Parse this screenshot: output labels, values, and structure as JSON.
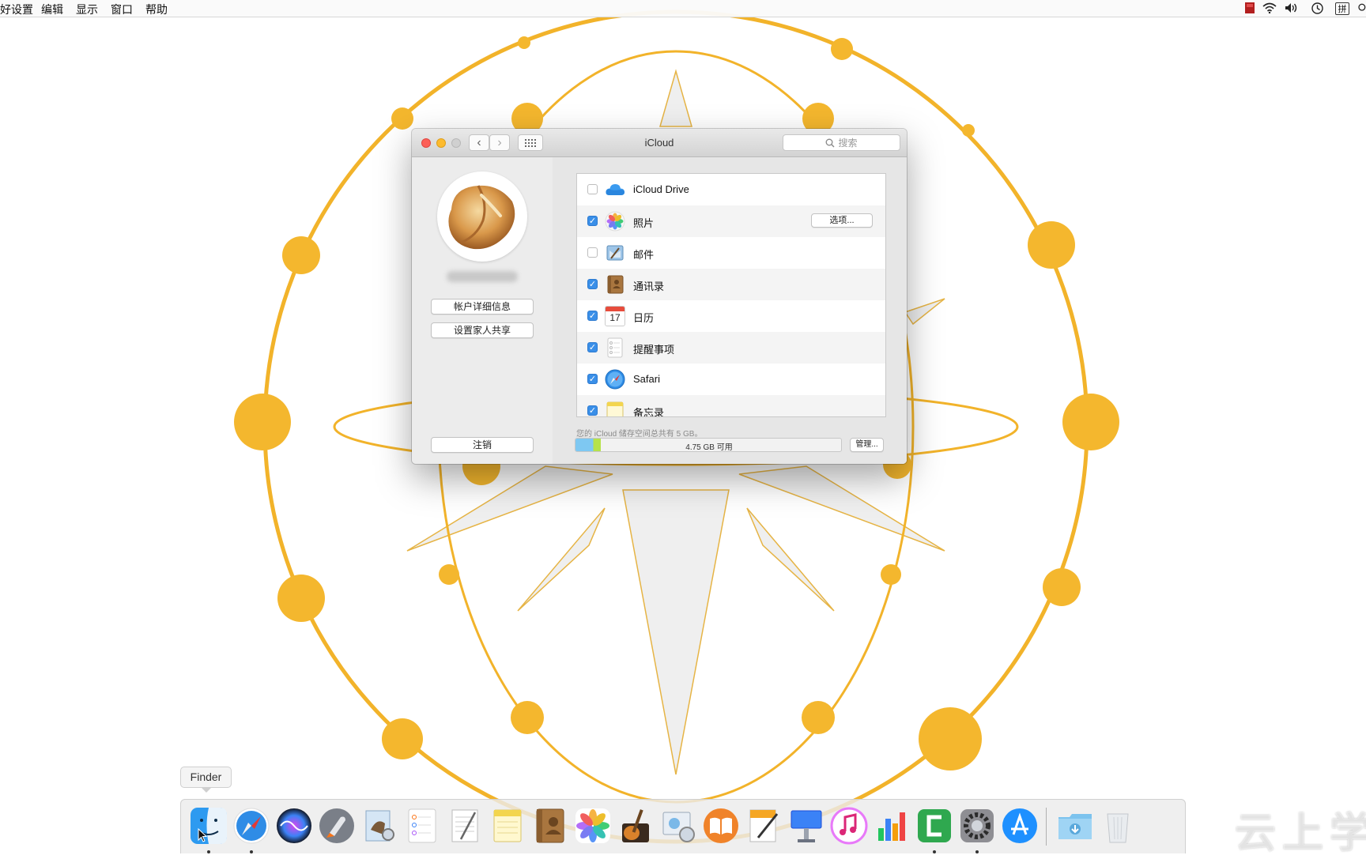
{
  "menubar": {
    "items": [
      "好设置",
      "编辑",
      "显示",
      "窗口",
      "帮助"
    ],
    "status_icons": [
      "flag-icon",
      "wifi-icon",
      "volume-icon",
      "clock-icon",
      "input-method-icon",
      "search-icon"
    ],
    "input_method_label": "拼"
  },
  "window": {
    "title": "iCloud",
    "search_placeholder": "搜索",
    "account": {
      "details_button": "帐户详细信息",
      "family_button": "设置家人共享",
      "signout_button": "注销"
    },
    "services": [
      {
        "name": "iCloud Drive",
        "checked": false,
        "icon": "icloud-drive-icon"
      },
      {
        "name": "照片",
        "checked": true,
        "icon": "photos-icon",
        "options_label": "选项..."
      },
      {
        "name": "邮件",
        "checked": false,
        "icon": "mail-icon"
      },
      {
        "name": "通讯录",
        "checked": true,
        "icon": "contacts-icon"
      },
      {
        "name": "日历",
        "checked": true,
        "icon": "calendar-icon",
        "calendar_day": "17"
      },
      {
        "name": "提醒事项",
        "checked": true,
        "icon": "reminders-icon"
      },
      {
        "name": "Safari",
        "checked": true,
        "icon": "safari-icon"
      },
      {
        "name": "备忘录",
        "checked": true,
        "icon": "notes-icon"
      }
    ],
    "storage": {
      "caption": "您的 iCloud 储存空间总共有 5 GB。",
      "available_text": "4.75 GB 可用",
      "used_fraction": 0.095,
      "manage_button": "管理..."
    }
  },
  "dock": {
    "tooltip": "Finder",
    "apps": [
      "finder-icon",
      "safari-icon",
      "siri-icon",
      "launchpad-icon",
      "preview-icon",
      "reminders-icon",
      "textedit-icon",
      "notes-icon",
      "contacts-icon",
      "photos-icon",
      "garageband-icon",
      "image-capture-icon",
      "ibooks-icon",
      "pages-icon",
      "keynote-icon",
      "itunes-icon",
      "numbers-icon",
      "camtasia-icon",
      "system-preferences-icon",
      "app-store-icon",
      "downloads-folder-icon",
      "trash-icon"
    ]
  },
  "watermark": "云上学堂",
  "colors": {
    "wallpaper_gold": "#f2b32a",
    "checkbox_blue": "#3a8fe8",
    "close": "#fc5f57",
    "minimize": "#fdbb2e",
    "zoom": "#d0d0d0"
  }
}
